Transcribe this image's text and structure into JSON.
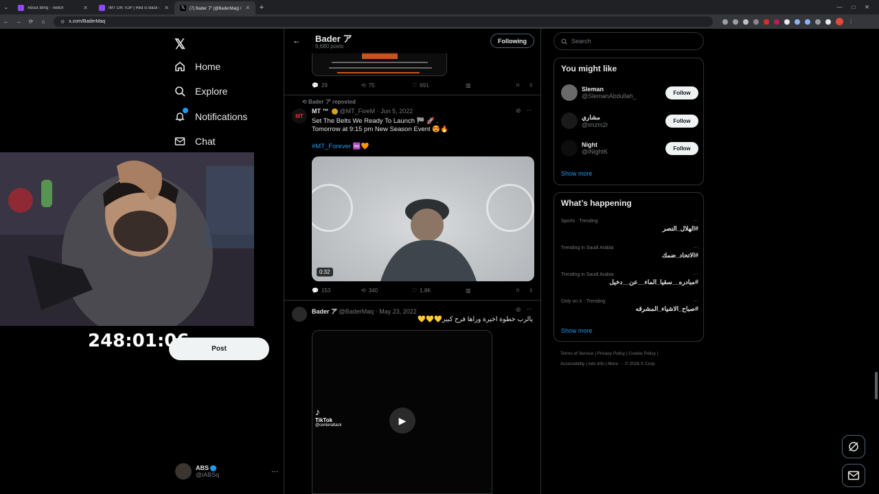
{
  "browser": {
    "tabs": [
      {
        "title": "About ibmq - Twitch",
        "active": false,
        "color": "#9146ff"
      },
      {
        "title": "IMT ON TOP | Red is Back - Twi…",
        "active": false,
        "color": "#9146ff"
      },
      {
        "title": "(7) Bader ア (@BaderMaq) / X",
        "active": true,
        "color": "#ffffff"
      }
    ],
    "url": "x.com/BaderMaq"
  },
  "nav": {
    "items": [
      {
        "label": "Home",
        "icon": "home-icon"
      },
      {
        "label": "Explore",
        "icon": "search-icon"
      },
      {
        "label": "Notifications",
        "icon": "bell-icon"
      },
      {
        "label": "Chat",
        "icon": "mail-icon"
      }
    ],
    "post_label": "Post",
    "account": {
      "name": "ABS",
      "handle": "@iABSq"
    }
  },
  "overlay": {
    "timer": "248:01:06"
  },
  "profile_header": {
    "name": "Bader ア",
    "posts": "6,680 posts",
    "following_label": "Following"
  },
  "tweets": [
    {
      "replies": "29",
      "reposts": "75",
      "likes": "691"
    },
    {
      "repost_by": "Bader ア reposted",
      "author": "MT ™",
      "handle": "@MT_FiveM",
      "date": "Jun 5, 2022",
      "line1": "Set The Belts We Ready To Launch 🏁 🚀 .",
      "line2": "Tomorrow at 9:15 pm  New Season Event 😍🔥",
      "hashtag": "#MT_Forever ♾️🧡",
      "duration": "0:32",
      "replies": "153",
      "reposts": "340",
      "likes": "1.8K"
    },
    {
      "author": "Bader ア",
      "handle": "@BaderMaq",
      "date": "May 23, 2022",
      "text": "يالرب خطوة اخيرة وراها فرح كبير💛💛💛",
      "tiktok_brand": "TikTok",
      "tiktok_user": "@centeraltack"
    }
  ],
  "search": {
    "placeholder": "Search"
  },
  "who_to_follow": {
    "title": "You might like",
    "users": [
      {
        "name": "Sleman",
        "handle": "@SlemanAbdullah_",
        "button": "Follow"
      },
      {
        "name": "مشاري",
        "handle": "@imzm2r",
        "button": "Follow"
      },
      {
        "name": "Night",
        "handle": "@iNightK",
        "button": "Follow"
      }
    ],
    "show_more": "Show more"
  },
  "happening": {
    "title": "What’s happening",
    "trends": [
      {
        "category": "Sports · Trending",
        "tag": "#الهلال_النصر"
      },
      {
        "category": "Trending in Saudi Arabia",
        "tag": "#الاتحاد_ضمك"
      },
      {
        "category": "Trending in Saudi Arabia",
        "tag": "#مبادره__سقيا_الماء__عن__دخيل"
      },
      {
        "category": "Only on X · Trending",
        "tag": "#صباح_الاشياء_المشرقه"
      }
    ],
    "show_more": "Show more"
  },
  "footer": {
    "line1": "Terms of Service  |  Privacy Policy  |  Cookie Policy  |",
    "line2": "Accessibility  |  Ads info  |  More ···  © 2026 X Corp."
  },
  "colors": {
    "accent": "#1d9bf0",
    "bg": "#000000",
    "border": "#2f3336"
  }
}
